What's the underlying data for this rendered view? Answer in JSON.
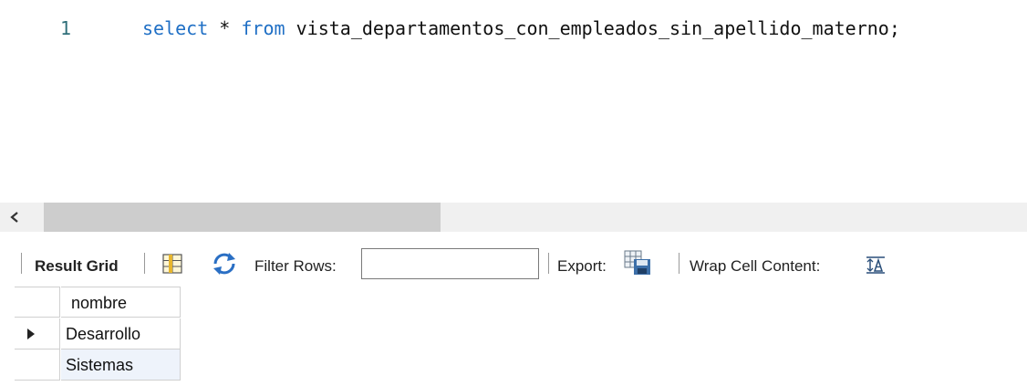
{
  "editor": {
    "line_number": "1",
    "keyword_select": "select",
    "star": "*",
    "keyword_from": "from",
    "table_name": "vista_departamentos_con_empleados_sin_apellido_materno;"
  },
  "toolbar": {
    "result_grid_label": "Result Grid",
    "filter_rows_label": "Filter Rows:",
    "filter_rows_value": "",
    "export_label": "Export:",
    "wrap_cell_label": "Wrap Cell Content:"
  },
  "grid": {
    "columns": [
      "nombre"
    ],
    "rows": [
      [
        "Desarrollo"
      ],
      [
        "Sistemas"
      ]
    ],
    "current_row_index": 0
  },
  "colors": {
    "keyword": "#1f6fc5",
    "line_number": "#2f6f7a",
    "scroll_track": "#f0f0f0",
    "scroll_thumb": "#cdcdcd",
    "alt_row": "#eef3fb"
  }
}
